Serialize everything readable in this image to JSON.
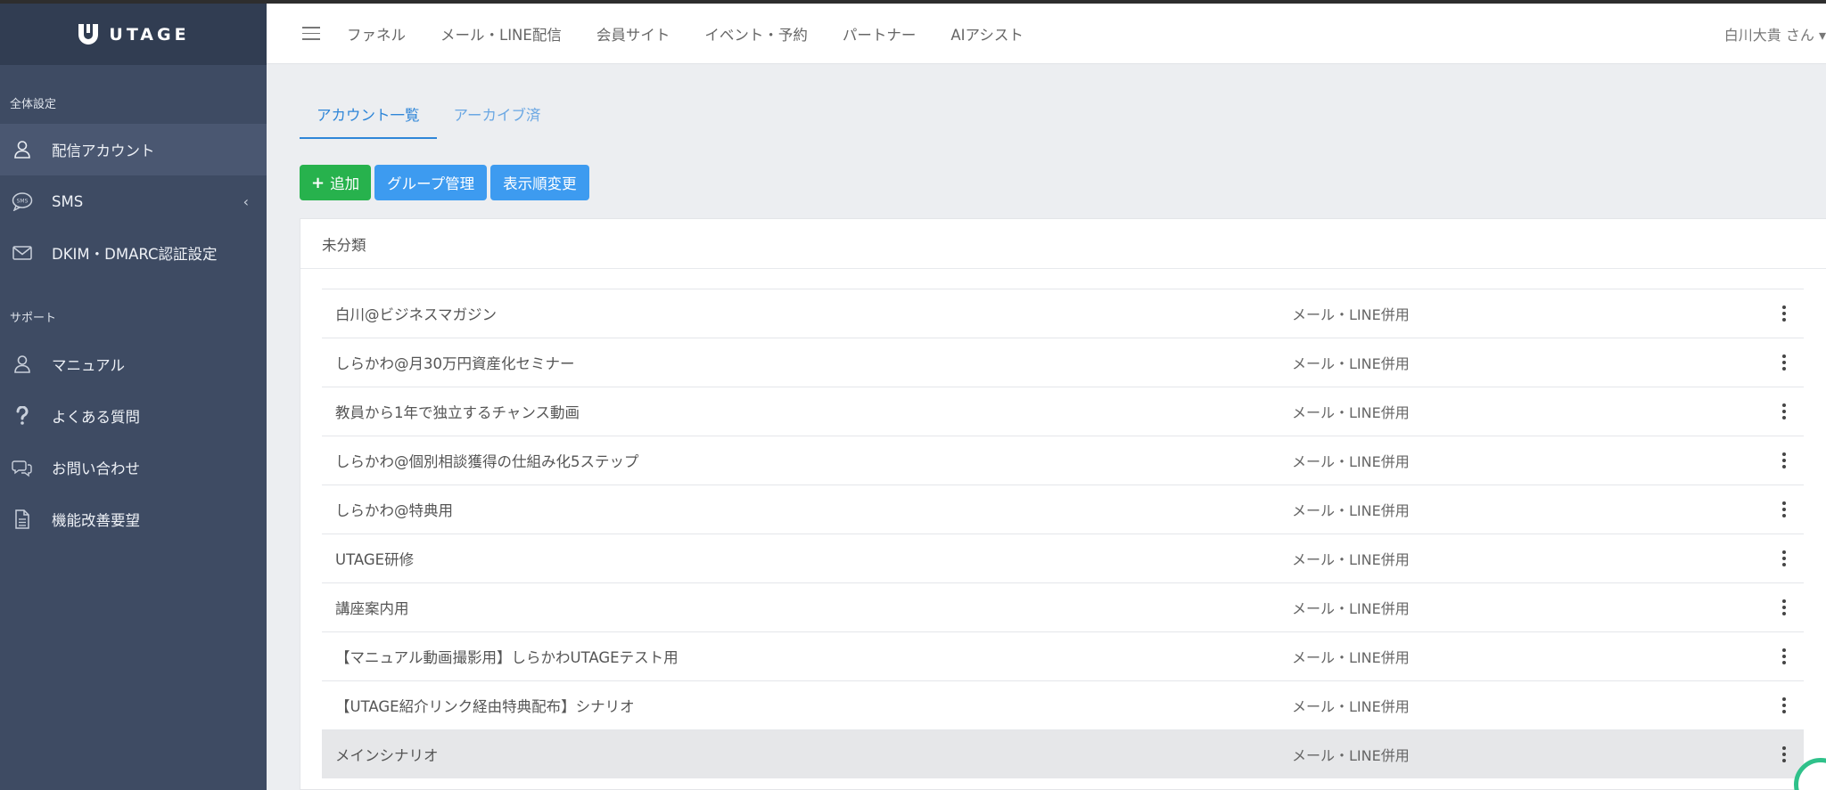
{
  "app": {
    "brand": "UTAGE"
  },
  "header": {
    "menu": [
      "ファネル",
      "メール・LINE配信",
      "会員サイト",
      "イベント・予約",
      "パートナー",
      "AIアシスト"
    ],
    "user": "白川大貴 さん ▾"
  },
  "sidebar": {
    "section1": "全体設定",
    "section2": "サポート",
    "items": [
      {
        "label": "配信アカウント",
        "icon": "user-icon"
      },
      {
        "label": "SMS",
        "icon": "sms-bubble-icon",
        "arrow": "‹"
      },
      {
        "label": "DKIM・DMARC認証設定",
        "icon": "mail-icon"
      },
      {
        "label": "マニュアル",
        "icon": "user-icon"
      },
      {
        "label": "よくある質問",
        "icon": "question-icon"
      },
      {
        "label": "お問い合わせ",
        "icon": "chat-icon"
      },
      {
        "label": "機能改善要望",
        "icon": "document-icon"
      }
    ]
  },
  "tabs": [
    "アカウント一覧",
    "アーカイブ済"
  ],
  "buttons": {
    "add": "追加",
    "add_icon": "+",
    "group": "グループ管理",
    "order": "表示順変更"
  },
  "card": {
    "title": "未分類",
    "rows": [
      {
        "name": "白川@ビジネスマガジン",
        "type": "メール・LINE併用"
      },
      {
        "name": "しらかわ@月30万円資産化セミナー",
        "type": "メール・LINE併用"
      },
      {
        "name": "教員から1年で独立するチャンス動画",
        "type": "メール・LINE併用"
      },
      {
        "name": "しらかわ@個別相談獲得の仕組み化5ステップ",
        "type": "メール・LINE併用"
      },
      {
        "name": "しらかわ@特典用",
        "type": "メール・LINE併用"
      },
      {
        "name": "UTAGE研修",
        "type": "メール・LINE併用"
      },
      {
        "name": "講座案内用",
        "type": "メール・LINE併用"
      },
      {
        "name": "【マニュアル動画撮影用】しらかわUTAGEテスト用",
        "type": "メール・LINE併用"
      },
      {
        "name": "【UTAGE紹介リンク経由特典配布】シナリオ",
        "type": "メール・LINE併用"
      },
      {
        "name": "メインシナリオ",
        "type": "メール・LINE併用"
      }
    ]
  },
  "colors": {
    "sidebar": "#3e4b63",
    "accent": "#2f86d8",
    "add_button": "#27b24d",
    "blue_button": "#3d9bf0"
  }
}
